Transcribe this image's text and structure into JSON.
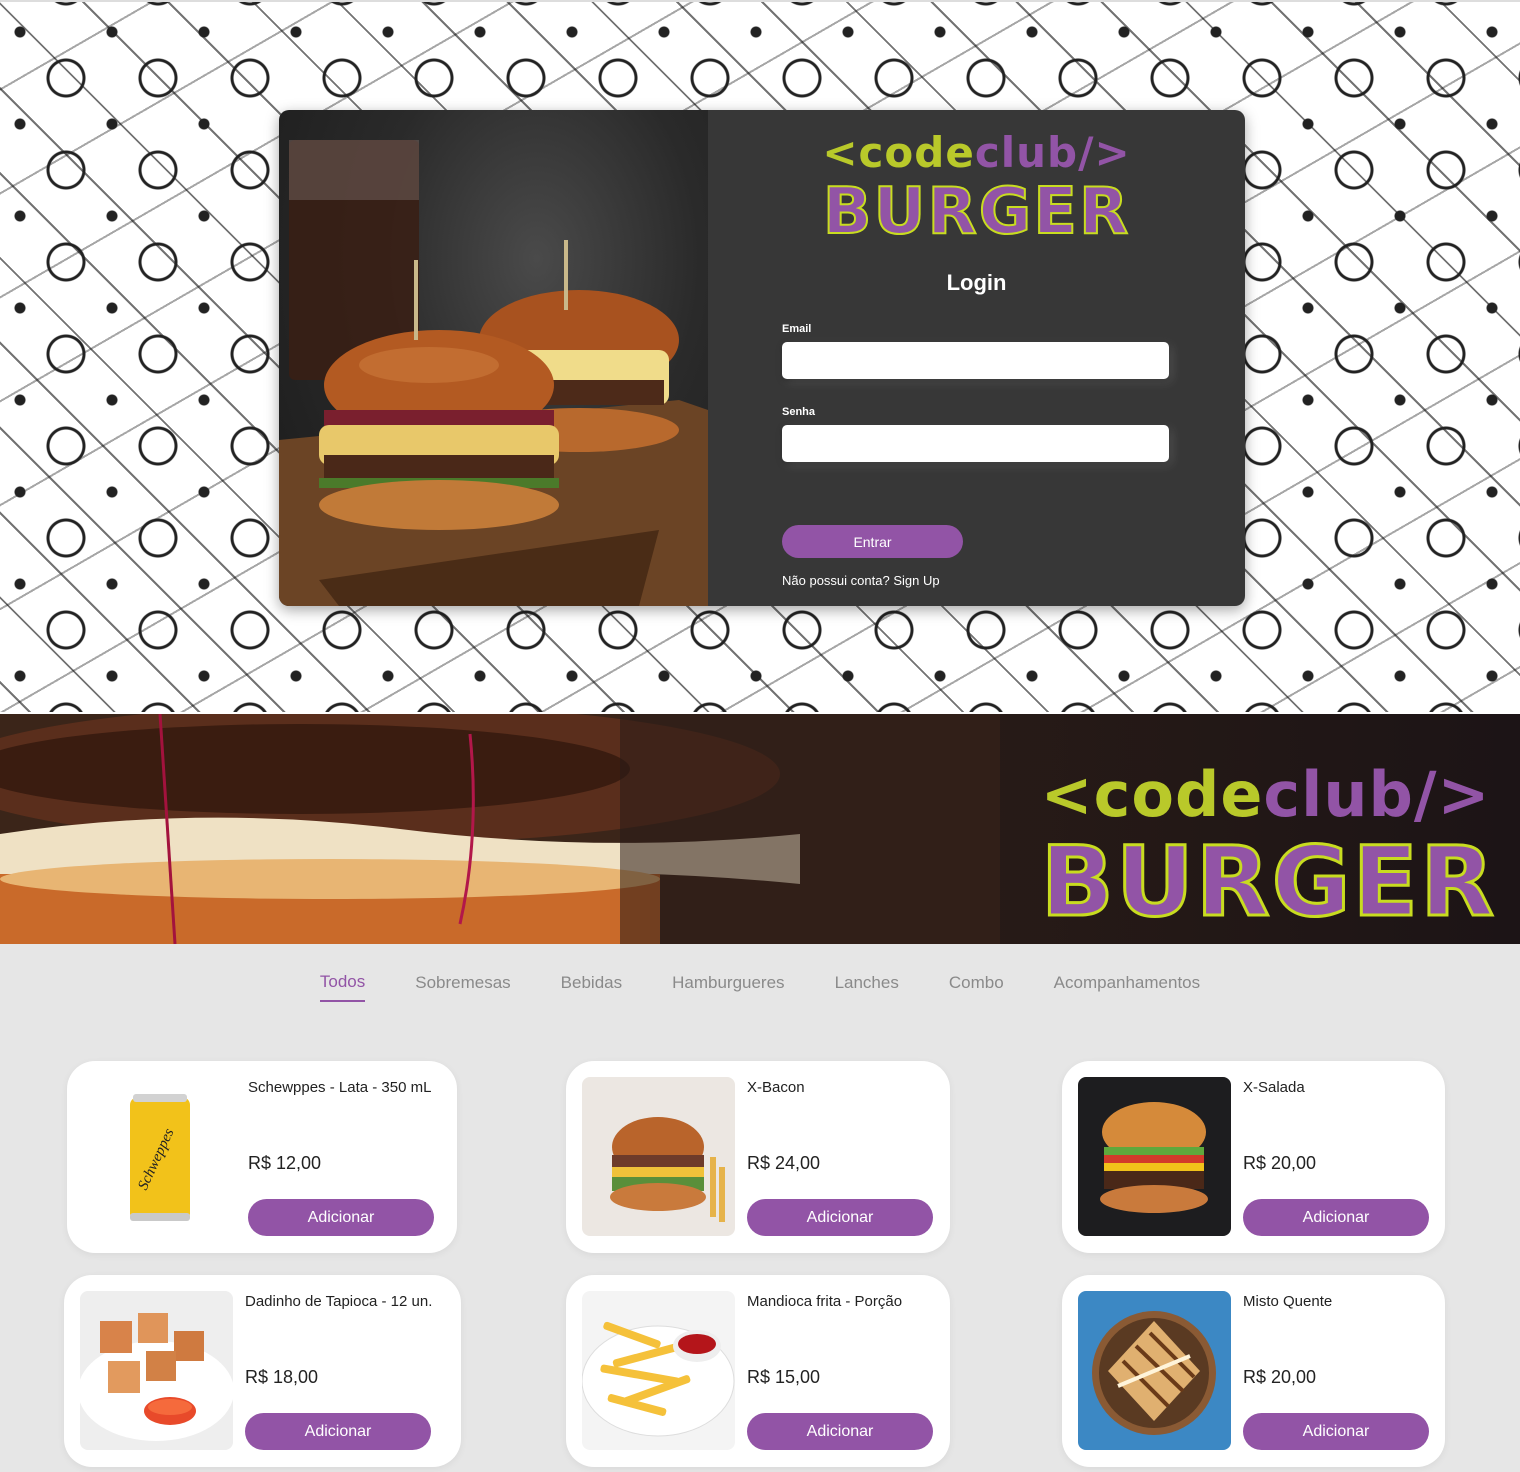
{
  "login": {
    "logo_code_prefix": "<code",
    "logo_code_suffix": "club/>",
    "logo_burger": "BURGER",
    "title": "Login",
    "email_label": "Email",
    "email_value": "",
    "password_label": "Senha",
    "password_value": "",
    "submit_label": "Entrar",
    "signup_prompt": "Não possui conta?",
    "signup_link": "Sign Up"
  },
  "banner": {
    "logo_code_prefix": "<code",
    "logo_code_suffix": "club/>",
    "logo_burger": "BURGER"
  },
  "tabs": [
    {
      "label": "Todos",
      "active": true
    },
    {
      "label": "Sobremesas",
      "active": false
    },
    {
      "label": "Bebidas",
      "active": false
    },
    {
      "label": "Hamburgueres",
      "active": false
    },
    {
      "label": "Lanches",
      "active": false
    },
    {
      "label": "Combo",
      "active": false
    },
    {
      "label": "Acompanhamentos",
      "active": false
    }
  ],
  "products": [
    {
      "name": "Schewppes - Lata - 350 mL",
      "price": "R$ 12,00",
      "button": "Adicionar",
      "image": "schweppes-can-icon"
    },
    {
      "name": "X-Bacon",
      "price": "R$ 24,00",
      "button": "Adicionar",
      "image": "burger-icon"
    },
    {
      "name": "X-Salada",
      "price": "R$ 20,00",
      "button": "Adicionar",
      "image": "burger-icon"
    },
    {
      "name": "Dadinho de Tapioca - 12 un.",
      "price": "R$ 18,00",
      "button": "Adicionar",
      "image": "tapioca-cubes-icon"
    },
    {
      "name": "Mandioca frita - Porção",
      "price": "R$ 15,00",
      "button": "Adicionar",
      "image": "fries-icon"
    },
    {
      "name": "Misto Quente",
      "price": "R$ 20,00",
      "button": "Adicionar",
      "image": "toast-sandwich-icon"
    }
  ],
  "colors": {
    "brand_purple": "#9254a6",
    "brand_lime": "#b9c92a",
    "panel_dark": "#373737",
    "menu_bg": "#e6e6e6"
  }
}
